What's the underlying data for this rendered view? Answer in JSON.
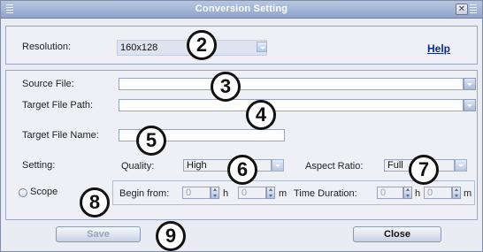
{
  "window": {
    "title": "Conversion Setting",
    "close_glyph": "✕"
  },
  "resolution": {
    "label": "Resolution:",
    "value": "160x128"
  },
  "help_link": "Help",
  "source_file": {
    "label": "Source File:",
    "value": ""
  },
  "target_path": {
    "label": "Target File Path:",
    "value": ""
  },
  "target_name": {
    "label": "Target File Name:",
    "value": ""
  },
  "setting": {
    "label": "Setting:",
    "quality_label": "Quality:",
    "quality_value": "High",
    "aspect_label": "Aspect Ratio:",
    "aspect_value": "Full"
  },
  "scope": {
    "label": "Scope",
    "begin_label": "Begin from:",
    "begin_h": "0",
    "begin_m": "0",
    "h_unit": "h",
    "m_unit": "m",
    "duration_label": "Time Duration:",
    "duration_h": "0",
    "duration_m": "0"
  },
  "buttons": {
    "save": "Save",
    "close": "Close"
  },
  "callouts": [
    "2",
    "3",
    "5",
    "4",
    "6",
    "7",
    "8",
    "9"
  ],
  "icons": {
    "browse": "chevron-down-icon",
    "spinner": "spinner-icon",
    "grip": "grip-icon"
  },
  "colors": {
    "title_bar": "#90a4c9",
    "link": "#0a2a9a",
    "panel": "#eef0f5"
  }
}
